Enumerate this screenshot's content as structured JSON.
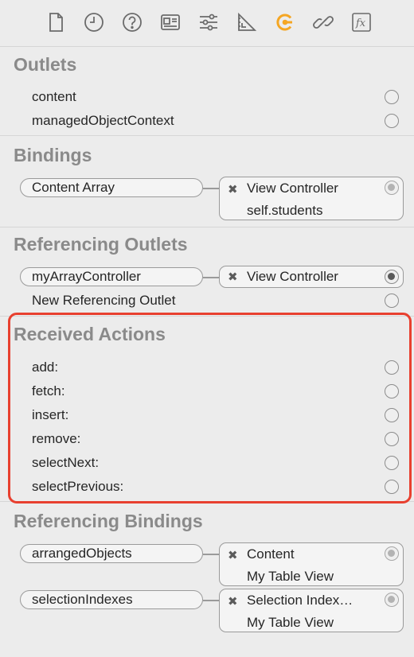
{
  "toolbar": {
    "icons": [
      "file-inspector-icon",
      "history-inspector-icon",
      "quick-help-icon",
      "identity-inspector-icon",
      "attributes-inspector-icon",
      "size-inspector-icon",
      "connections-inspector-icon",
      "bindings-inspector-icon",
      "effects-inspector-icon"
    ],
    "active": "connections-inspector-icon",
    "accent": "#f5a623"
  },
  "outlets": {
    "title": "Outlets",
    "items": [
      {
        "label": "content"
      },
      {
        "label": "managedObjectContext"
      }
    ]
  },
  "bindings": {
    "title": "Bindings",
    "items": [
      {
        "label": "Content Array",
        "target": "View Controller",
        "keypath": "self.students",
        "remove": "✖"
      }
    ]
  },
  "referencing_outlets": {
    "title": "Referencing Outlets",
    "items": [
      {
        "label": "myArrayController",
        "target": "View Controller",
        "remove": "✖"
      }
    ],
    "new_label": "New Referencing Outlet"
  },
  "received_actions": {
    "title": "Received Actions",
    "items": [
      {
        "label": "add:"
      },
      {
        "label": "fetch:"
      },
      {
        "label": "insert:"
      },
      {
        "label": "remove:"
      },
      {
        "label": "selectNext:"
      },
      {
        "label": "selectPrevious:"
      }
    ],
    "highlight_color": "#e8402f"
  },
  "referencing_bindings": {
    "title": "Referencing Bindings",
    "items": [
      {
        "label": "arrangedObjects",
        "target": "Content",
        "source": "My Table View",
        "remove": "✖"
      },
      {
        "label": "selectionIndexes",
        "target": "Selection Index…",
        "source": "My Table View",
        "remove": "✖"
      }
    ]
  }
}
